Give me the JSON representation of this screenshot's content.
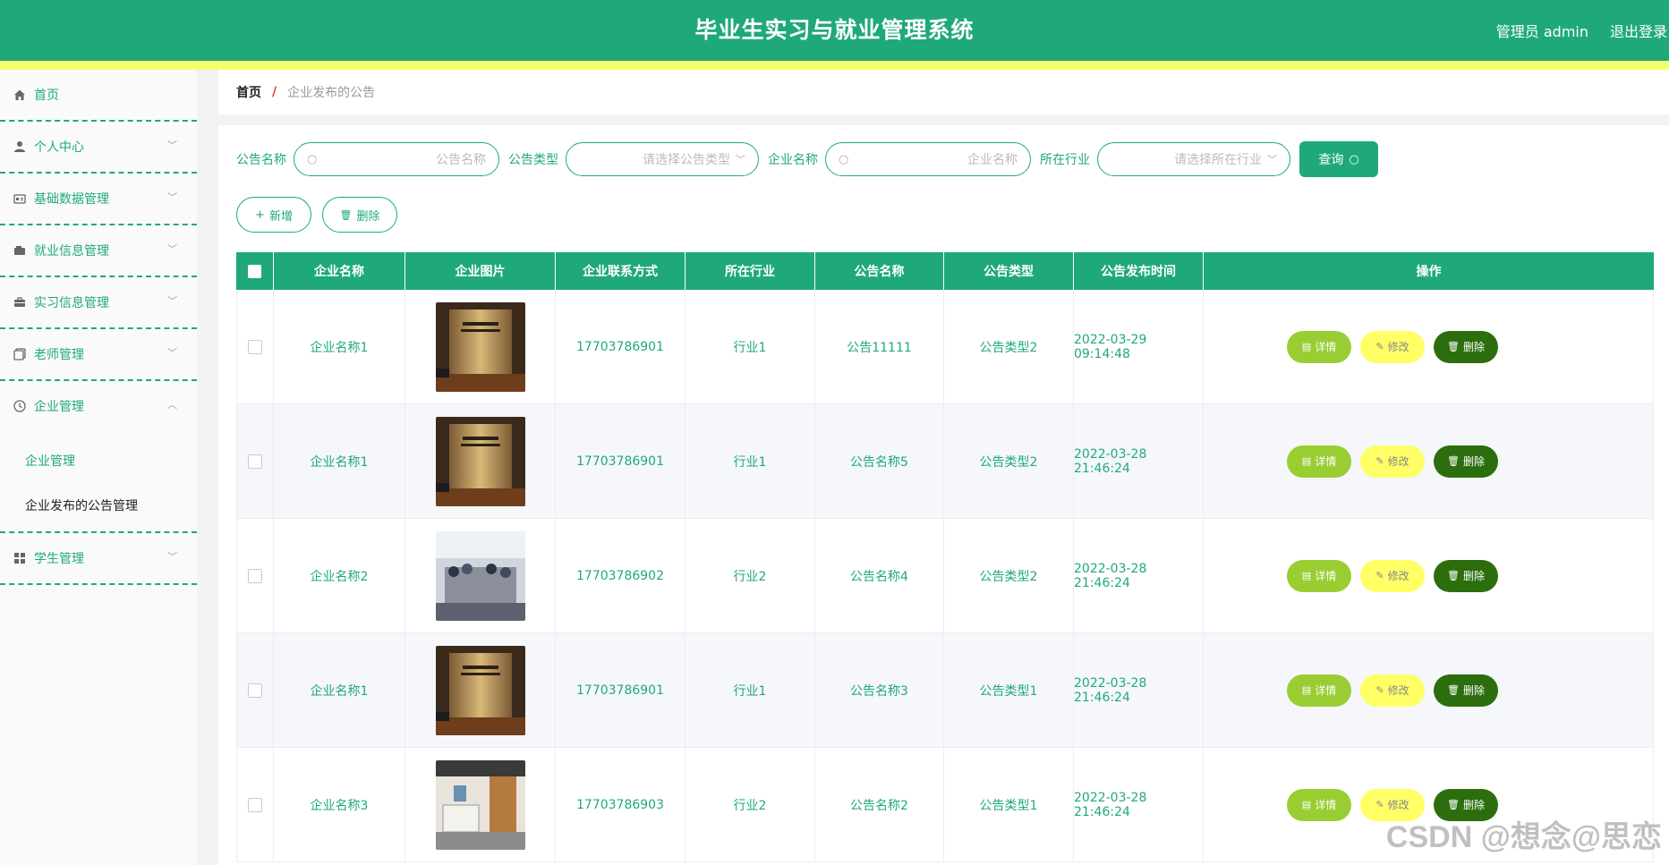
{
  "header": {
    "title": "毕业生实习与就业管理系统",
    "user": "管理员 admin",
    "logout": "退出登录"
  },
  "sidebar": {
    "items": [
      {
        "label": "首页",
        "icon": "home-icon"
      },
      {
        "label": "个人中心",
        "icon": "user-icon"
      },
      {
        "label": "基础数据管理",
        "icon": "id-card-icon"
      },
      {
        "label": "就业信息管理",
        "icon": "wallet-icon"
      },
      {
        "label": "实习信息管理",
        "icon": "briefcase-icon"
      },
      {
        "label": "老师管理",
        "icon": "copy-icon"
      },
      {
        "label": "企业管理",
        "icon": "clock-icon"
      },
      {
        "label": "学生管理",
        "icon": "grid-icon"
      }
    ],
    "submenu": [
      "企业管理",
      "企业发布的公告管理"
    ]
  },
  "breadcrumb": {
    "home": "首页",
    "separator": "/",
    "current": "企业发布的公告"
  },
  "search": {
    "name_label": "公告名称",
    "name_placeholder": "公告名称",
    "type_label": "公告类型",
    "type_placeholder": "请选择公告类型",
    "company_label": "企业名称",
    "company_placeholder": "企业名称",
    "industry_label": "所在行业",
    "industry_placeholder": "请选择所在行业",
    "query_button": "查询"
  },
  "actions": {
    "add": "新增",
    "delete": "删除"
  },
  "table": {
    "columns": [
      "企业名称",
      "企业图片",
      "企业联系方式",
      "所在行业",
      "公告名称",
      "公告类型",
      "公告发布时间",
      "操作"
    ],
    "rows": [
      {
        "company": "企业名称1",
        "phone": "17703786901",
        "industry": "行业1",
        "notice": "公告11111",
        "type": "公告类型2",
        "time": "2022-03-29 09:14:48",
        "image": "lobby"
      },
      {
        "company": "企业名称1",
        "phone": "17703786901",
        "industry": "行业1",
        "notice": "公告名称5",
        "type": "公告类型2",
        "time": "2022-03-28 21:46:24",
        "image": "lobby"
      },
      {
        "company": "企业名称2",
        "phone": "17703786902",
        "industry": "行业2",
        "notice": "公告名称4",
        "type": "公告类型2",
        "time": "2022-03-28 21:46:24",
        "image": "meeting"
      },
      {
        "company": "企业名称1",
        "phone": "17703786901",
        "industry": "行业1",
        "notice": "公告名称3",
        "type": "公告类型1",
        "time": "2022-03-28 21:46:24",
        "image": "lobby"
      },
      {
        "company": "企业名称3",
        "phone": "17703786903",
        "industry": "行业2",
        "notice": "公告名称2",
        "type": "公告类型1",
        "time": "2022-03-28 21:46:24",
        "image": "office"
      }
    ],
    "row_buttons": {
      "detail": "详情",
      "edit": "修改",
      "delete": "删除"
    }
  },
  "watermark": "CSDN @想念@思恋",
  "colors": {
    "primary": "#1fa97a",
    "stripe": "#f6ff6e",
    "detail": "#9acd32",
    "edit": "#ffff66",
    "delete": "#2c6e0e"
  }
}
